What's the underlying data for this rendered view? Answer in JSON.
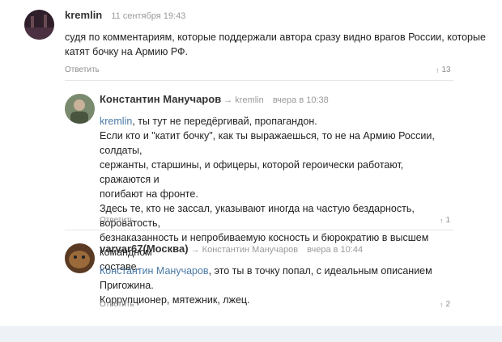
{
  "comments": [
    {
      "author": "kremlin",
      "reply_to": "",
      "time": "11 сентября 19:43",
      "lines": [
        "судя по комментариям, которые поддержали автора сразу видно врагов России, которые",
        "катят бочку на Армию РФ."
      ],
      "reply_label": "Ответить",
      "votes": "13",
      "avatar_icon": "avatar-kremlin-icon"
    },
    {
      "author": "Константин Манучаров",
      "reply_to": "→ kremlin",
      "time": "вчера в 10:38",
      "mention": "kremlin",
      "first_line_rest": ", ты тут не передёргивай, пропагандон.",
      "lines": [
        "Если кто и \"катит бочку\", как ты выражаешься, то не на Армию России, солдаты,",
        "сержанты, старшины, и офицеры, которой героически работают, сражаются и",
        "погибают на фронте.",
        "Здесь те, кто не зассал, указывают иногда на частую бездарность, вороватость,",
        "безнаказанность и непробиваемую косность и бюрократию в высшем командном",
        "составе."
      ],
      "reply_label": "Ответить",
      "votes": "1",
      "avatar_icon": "avatar-manucharov-icon"
    },
    {
      "author": "varvar67(Москва)",
      "reply_to": "→ Константин Манучаров",
      "time": "вчера в 10:44",
      "mention": "Константин Манучаров",
      "first_line_rest": ", это ты в точку попал, с идеальным описанием Пригожина.",
      "lines": [
        "Коррупционер, мятежник, лжец."
      ],
      "reply_label": "Ответить",
      "votes": "2",
      "avatar_icon": "avatar-varvar-icon"
    }
  ],
  "colors": {
    "mention": "#4a7aa7",
    "footer": "#eef2f7"
  }
}
